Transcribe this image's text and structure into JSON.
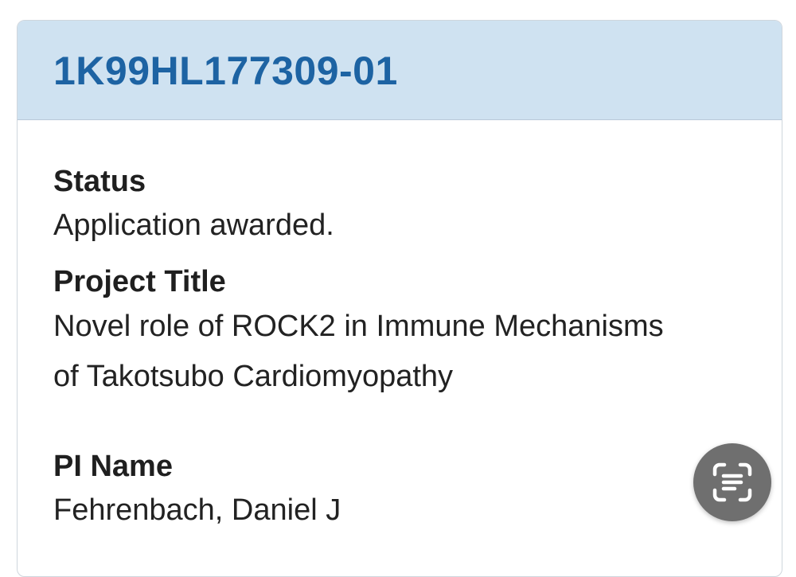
{
  "record": {
    "grant_id": "1K99HL177309-01",
    "status_label": "Status",
    "status_value": "Application awarded.",
    "project_title_label": "Project Title",
    "project_title_line1": "Novel role of ROCK2 in Immune Mechanisms",
    "project_title_line2": "of Takotsubo Cardiomyopathy",
    "pi_name_label": "PI Name",
    "pi_name_value": "Fehrenbach, Daniel J"
  },
  "overlay": {
    "lens_icon": "text-scan-icon"
  },
  "colors": {
    "header_bg": "#cfe2f1",
    "grant_id": "#1d63a3",
    "lens_bg": "#6f6f6f"
  }
}
